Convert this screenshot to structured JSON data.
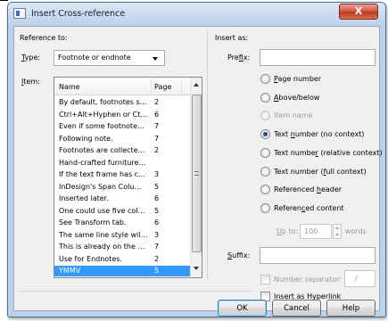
{
  "window": {
    "title": "Insert Cross-reference",
    "close_glyph": "X"
  },
  "reference_to": {
    "section_label": "Reference to:",
    "type_label": "Type:",
    "type_value": "Footnote or endnote",
    "item_label": "Item:",
    "columns": [
      "Name",
      "Page"
    ],
    "items": [
      {
        "name": "By default, footnotes s...",
        "page": "2"
      },
      {
        "name": "Ctrl+Alt+Hyphen or Ctr...",
        "page": "6"
      },
      {
        "name": "Even if some footnotes ...",
        "page": "7"
      },
      {
        "name": "Following note.",
        "page": "7"
      },
      {
        "name": "Footnotes are collected...",
        "page": "2"
      },
      {
        "name": "Hand-crafted furniture i...",
        "page": ""
      },
      {
        "name": "If the text frame has c...",
        "page": "3"
      },
      {
        "name": "InDesign's Span Column...",
        "page": "5"
      },
      {
        "name": "Inserted later.",
        "page": "6"
      },
      {
        "name": "One could use five colu...",
        "page": "5"
      },
      {
        "name": "See Transform tab.",
        "page": "6"
      },
      {
        "name": "The same line style will ...",
        "page": "3"
      },
      {
        "name": "This is already on the w...",
        "page": "7"
      },
      {
        "name": "Use for Endnotes.",
        "page": "2"
      },
      {
        "name": "YMMV",
        "page": "5"
      }
    ],
    "selected_index": 14
  },
  "insert_as": {
    "section_label": "Insert as:",
    "prefix_label": "Prefix:",
    "prefix_value": "",
    "options": [
      {
        "label": "Page number",
        "checked": false,
        "enabled": true
      },
      {
        "label": "Above/below",
        "checked": false,
        "enabled": true
      },
      {
        "label": "Item name",
        "checked": false,
        "enabled": false
      },
      {
        "label": "Text number (no context)",
        "checked": true,
        "enabled": true
      },
      {
        "label": "Text number (relative context)",
        "checked": false,
        "enabled": true
      },
      {
        "label": "Text number (full context)",
        "checked": false,
        "enabled": true
      },
      {
        "label": "Referenced header",
        "checked": false,
        "enabled": true
      },
      {
        "label": "Referenced content",
        "checked": false,
        "enabled": true
      }
    ],
    "up_to_label": "Up to:",
    "up_to_value": "100",
    "words_label": "words",
    "suffix_label": "Suffix:",
    "suffix_value": "",
    "number_separator_label": "Number separator:",
    "number_separator_value": "/",
    "hyperlink_label": "Insert as Hyperlink"
  },
  "buttons": {
    "ok": "OK",
    "cancel": "Cancel",
    "help": "Help"
  }
}
